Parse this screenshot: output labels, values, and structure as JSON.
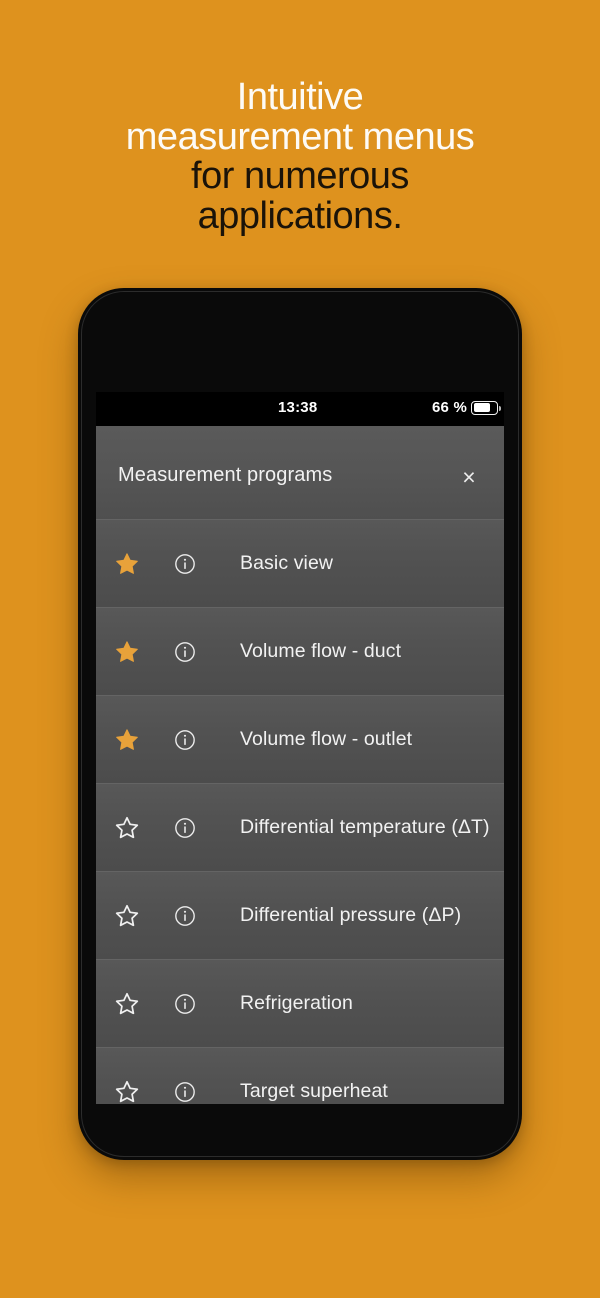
{
  "marketing": {
    "headline_lines": [
      {
        "text": "Intuitive",
        "color_style": "light"
      },
      {
        "text": "measurement menus",
        "color_style": "light"
      },
      {
        "text": "for numerous",
        "color_style": "dark"
      },
      {
        "text": "applications.",
        "color_style": "dark"
      }
    ],
    "background_color": "#de921e",
    "light_text_color": "#fdfbf6",
    "dark_text_color": "#1a1309"
  },
  "phone": {
    "status_bar": {
      "time": "13:38",
      "battery_percent": "66 %",
      "battery_level": 66,
      "battery_icon": "battery-icon"
    },
    "modal": {
      "title": "Measurement programs",
      "close_label": "×",
      "close_icon": "close-icon",
      "header_background": "#555555"
    },
    "list": {
      "star_filled_color": "#e8a23a",
      "star_empty_color": "#f0f0f0",
      "row_background": "#525252",
      "items": [
        {
          "label": "Basic view",
          "favorite": true,
          "star_icon": "star-filled-icon",
          "info_icon": "info-circle-icon"
        },
        {
          "label": "Volume flow - duct",
          "favorite": true,
          "star_icon": "star-filled-icon",
          "info_icon": "info-circle-icon"
        },
        {
          "label": "Volume flow - outlet",
          "favorite": true,
          "star_icon": "star-filled-icon",
          "info_icon": "info-circle-icon"
        },
        {
          "label": "Differential temperature (ΔT)",
          "favorite": false,
          "star_icon": "star-outline-icon",
          "info_icon": "info-circle-icon"
        },
        {
          "label": "Differential pressure (ΔP)",
          "favorite": false,
          "star_icon": "star-outline-icon",
          "info_icon": "info-circle-icon"
        },
        {
          "label": "Refrigeration",
          "favorite": false,
          "star_icon": "star-outline-icon",
          "info_icon": "info-circle-icon"
        },
        {
          "label": "Target superheat",
          "favorite": false,
          "star_icon": "star-outline-icon",
          "info_icon": "info-circle-icon"
        }
      ]
    }
  }
}
